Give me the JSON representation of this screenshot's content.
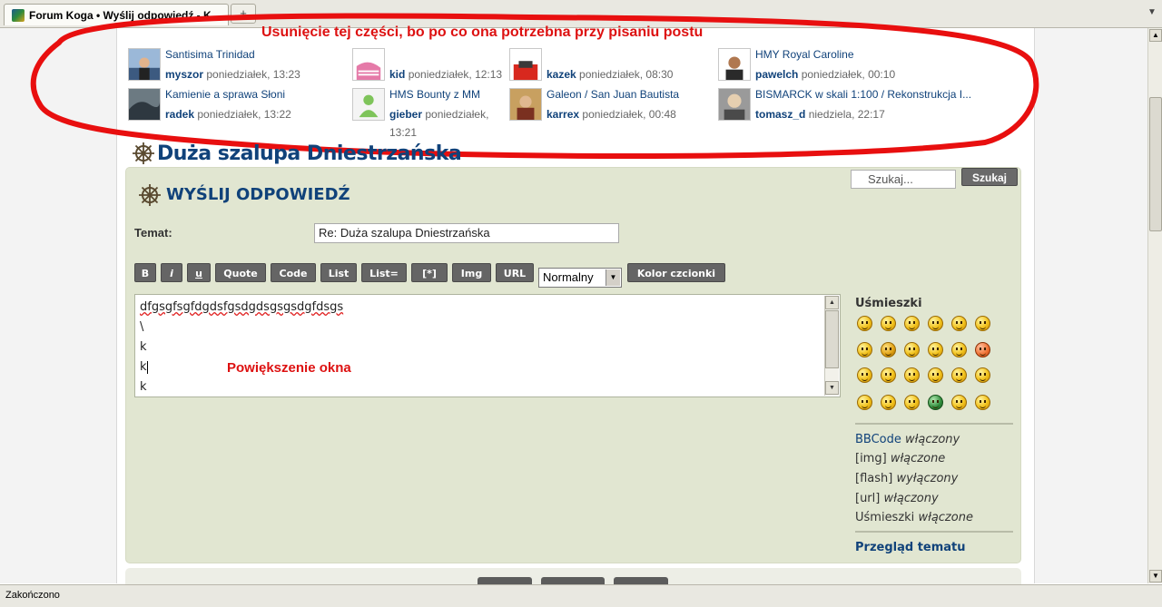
{
  "browser": {
    "tab_title": "Forum Koga • Wyślij odpowiedź - Ko...",
    "new_tab_label": "+",
    "status_text": "Zakończono"
  },
  "annotations": {
    "top_note": "Usunięcie tej części, bo po co ona potrzebna przy pisaniu postu",
    "resize_note": "Powiększenie okna",
    "color": "#dd1111"
  },
  "recent_posts": [
    {
      "title": "Santisima Trinidad",
      "user": "myszor",
      "date": "poniedziałek, 13:23"
    },
    {
      "title": "",
      "user": "kid",
      "date": "poniedziałek, 12:13"
    },
    {
      "title": "",
      "user": "kazek",
      "date": "poniedziałek, 08:30"
    },
    {
      "title": "HMY Royal Caroline",
      "user": "pawelch",
      "date": "poniedziałek, 00:10"
    },
    {
      "title": "Kamienie a sprawa Słoni",
      "user": "radek",
      "date": "poniedziałek, 13:22"
    },
    {
      "title": "HMS Bounty z MM",
      "user": "gieber",
      "date": "poniedziałek,",
      "date_extra": "13:21"
    },
    {
      "title": "Galeon / San Juan Bautista",
      "user": "karrex",
      "date": "poniedziałek, 00:48"
    },
    {
      "title": "BISMARCK w skali 1:100 / Rekonstrukcja I...",
      "user": "tomasz_d",
      "date": "niedziela, 22:17"
    }
  ],
  "topic": {
    "title": "Duża szalupa Dniestrzańska"
  },
  "search": {
    "placeholder": "Szukaj...",
    "button": "Szukaj"
  },
  "reply": {
    "heading": "WYŚLIJ ODPOWIEDŹ",
    "subject_label": "Temat:",
    "subject_value": "Re: Duża szalupa Dniestrzańska",
    "toolbar": {
      "bold": "B",
      "italic": "i",
      "underline": "u",
      "quote": "Quote",
      "code": "Code",
      "list": "List",
      "list_eq": "List=",
      "list_item": "[*]",
      "img": "Img",
      "url": "URL",
      "font_size": "Normalny",
      "font_color": "Kolor czcionki"
    },
    "message_lines": [
      "dfgsgfsgfdgdsfgsdgdsgsgsdgfdsgs",
      "\\",
      "k",
      "k",
      "k"
    ]
  },
  "sidebar": {
    "smilies_heading": "Uśmieszki",
    "bbcode_label": "BBCode",
    "bbcode_state": "włączony",
    "img_label": "[img]",
    "img_state": "włączone",
    "flash_label": "[flash]",
    "flash_state": "wyłączony",
    "url_label": "[url]",
    "url_state": "włączony",
    "smilies_label": "Uśmieszki",
    "smilies_state": "włączone",
    "preview_link": "Przegląd tematu"
  },
  "colors": {
    "link": "#10427a",
    "panel": "#e1e6d1",
    "button": "#656565"
  }
}
